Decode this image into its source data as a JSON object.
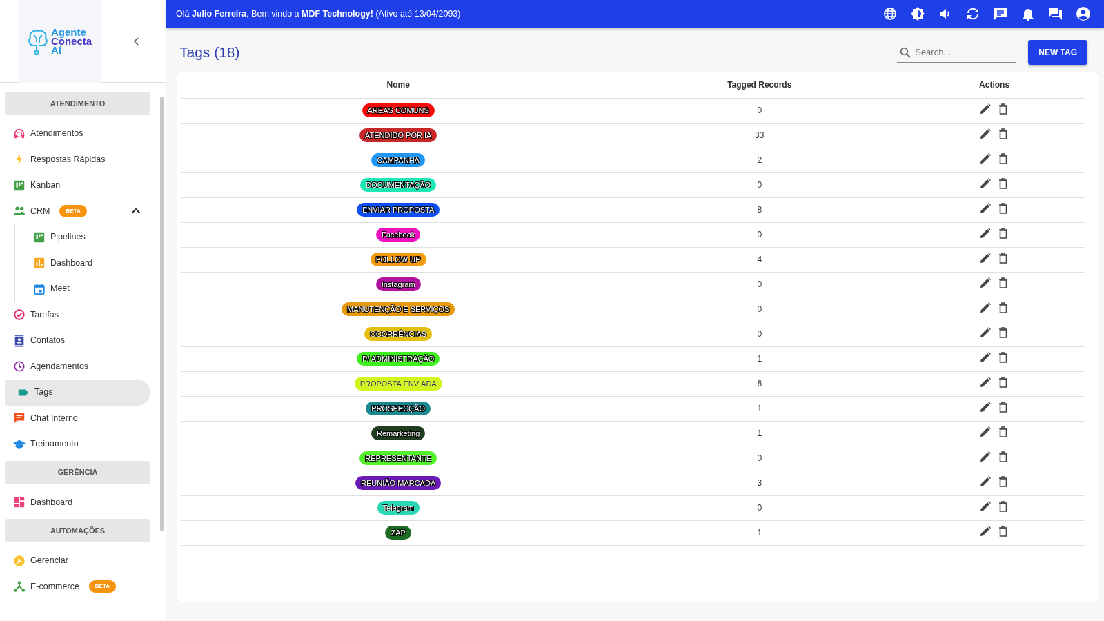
{
  "topbar": {
    "greeting": "Olá **Julio Ferreira**, Bem vindo a **MDF Technology!** (Ativo até 13/04/2093)"
  },
  "sidebar": {
    "logo_text": [
      "Agente",
      "Conecta",
      "Aí"
    ],
    "items": [
      {
        "kind": "section",
        "label": "ATENDIMENTO"
      },
      {
        "kind": "item",
        "label": "Atendimentos",
        "selected": false
      },
      {
        "kind": "item",
        "label": "Respostas Rápidas",
        "selected": false
      },
      {
        "kind": "item",
        "label": "Kanban",
        "selected": false
      },
      {
        "kind": "item",
        "label": "CRM",
        "badge": "BETA",
        "expanded": true,
        "selected": false,
        "children": [
          {
            "label": "Pipelines",
            "selected": false
          },
          {
            "label": "Dashboard",
            "selected": false
          },
          {
            "label": "Meet",
            "selected": false
          }
        ]
      },
      {
        "kind": "item",
        "label": "Tarefas",
        "selected": false
      },
      {
        "kind": "item",
        "label": "Contatos",
        "selected": false
      },
      {
        "kind": "item",
        "label": "Agendamentos",
        "selected": false
      },
      {
        "kind": "item",
        "label": "Tags",
        "selected": true
      },
      {
        "kind": "item",
        "label": "Chat Interno",
        "selected": false
      },
      {
        "kind": "item",
        "label": "Treinamento",
        "selected": false
      },
      {
        "kind": "section",
        "label": "GERÊNCIA"
      },
      {
        "kind": "item",
        "label": "Dashboard",
        "selected": false
      },
      {
        "kind": "section",
        "label": "AUTOMAÇÕES"
      },
      {
        "kind": "item",
        "label": "Gerenciar",
        "selected": false
      },
      {
        "kind": "item",
        "label": "E-commerce",
        "badge": "BETA",
        "selected": false
      }
    ]
  },
  "page": {
    "title": "Tags (18)",
    "search": {
      "placeholder": "Search..."
    },
    "new_button": "NEW TAG"
  },
  "table": {
    "columns": [
      "Nome",
      "Tagged Records",
      "Actions"
    ],
    "rows": [
      {
        "name": "AREAS COMUNS",
        "color": "#f50a0a",
        "records": "0"
      },
      {
        "name": "ATENDIDO POR IA",
        "color": "#c62828",
        "records": "33"
      },
      {
        "name": "CAMPANHA",
        "color": "#2196f3",
        "records": "2"
      },
      {
        "name": "DOCUMENTAÇÃO",
        "color": "#1de9b6",
        "records": "0"
      },
      {
        "name": "ENVIAR PROPOSTA",
        "color": "#0d4ff0",
        "records": "8"
      },
      {
        "name": "Facebook",
        "color": "#f012be",
        "records": "0"
      },
      {
        "name": "FOLLOW UP",
        "color": "#f39c12",
        "records": "4"
      },
      {
        "name": "Instagram",
        "color": "#b1139e",
        "records": "0"
      },
      {
        "name": "MANUTENÇÃO E SERVIÇOS",
        "color": "#e69a0c",
        "records": "0"
      },
      {
        "name": "OCORRÊNCIAS",
        "color": "#e3c010",
        "records": "0"
      },
      {
        "name": "P/ ADMINISTRAÇÃO",
        "color": "#3ff21f",
        "records": "1"
      },
      {
        "name": "PROPOSTA ENVIADA",
        "color": "#d4f51c",
        "records": "6"
      },
      {
        "name": "PROSPECÇÃO",
        "color": "#1b8a8f",
        "records": "1"
      },
      {
        "name": "Remarketing",
        "color": "#1f3d1e",
        "records": "1"
      },
      {
        "name": "REPRESENTANTE",
        "color": "#54f02c",
        "records": "0"
      },
      {
        "name": "REUNIÃO MARCADA",
        "color": "#6a1bb5",
        "records": "3"
      },
      {
        "name": "Telegram",
        "color": "#2ad8b4",
        "records": "0"
      },
      {
        "name": "ZAP",
        "color": "#1d6b22",
        "records": "1"
      }
    ]
  }
}
